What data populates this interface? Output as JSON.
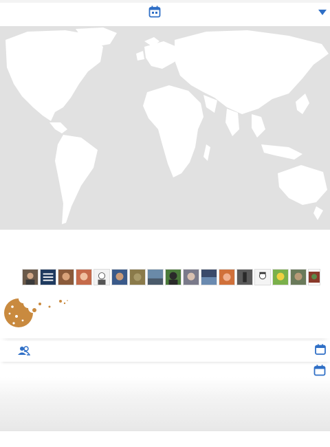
{
  "colors": {
    "accent": "#2f6fc6",
    "map_background": "#e1e1e1",
    "land": "#ffffff",
    "cookie": "#c98a3f"
  },
  "icons": {
    "top_calendar": "calendar-icon",
    "top_dropdown": "caret-down-icon",
    "cookie": "cookie-icon",
    "people": "people-icon",
    "row_calendar": "calendar-icon"
  },
  "avatars": [
    {
      "name": "avatar-1",
      "tone": "#6b5a4a"
    },
    {
      "name": "avatar-2",
      "tone": "#1f3a5f"
    },
    {
      "name": "avatar-3",
      "tone": "#8a5a3a"
    },
    {
      "name": "avatar-4",
      "tone": "#c56a4a"
    },
    {
      "name": "avatar-5",
      "tone": "#dcdcdc"
    },
    {
      "name": "avatar-6",
      "tone": "#3a5a8a"
    },
    {
      "name": "avatar-7",
      "tone": "#8a7a4a"
    },
    {
      "name": "avatar-8",
      "tone": "#6a8aa8"
    },
    {
      "name": "avatar-9",
      "tone": "#2a2a2a"
    },
    {
      "name": "avatar-10",
      "tone": "#7a7a8a"
    },
    {
      "name": "avatar-11",
      "tone": "#3a4a6a"
    },
    {
      "name": "avatar-12",
      "tone": "#d0703a"
    },
    {
      "name": "avatar-13",
      "tone": "#5a5a5a"
    },
    {
      "name": "avatar-14",
      "tone": "#e8e8e8"
    },
    {
      "name": "avatar-15",
      "tone": "#7ab04a"
    },
    {
      "name": "avatar-16",
      "tone": "#6a7a5a"
    },
    {
      "name": "avatar-17",
      "tone": "#8a3a2a"
    }
  ]
}
